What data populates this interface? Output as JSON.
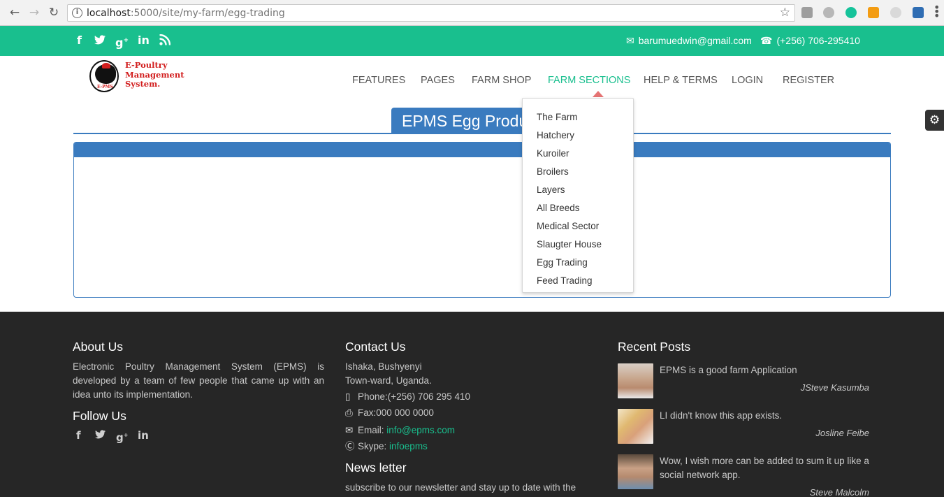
{
  "browser": {
    "url_host": "localhost",
    "url_path": ":5000/site/my-farm/egg-trading"
  },
  "topbar": {
    "social_icons": [
      "facebook-icon",
      "twitter-icon",
      "google-plus-icon",
      "linkedin-icon",
      "rss-icon"
    ],
    "email": "barumuedwin@gmail.com",
    "phone": "(+256) 706-295410"
  },
  "logo": {
    "line1": "E-Poultry",
    "line2": "Management",
    "line3": "System.",
    "badge": "E-PMS"
  },
  "nav": {
    "items": [
      "FEATURES",
      "PAGES",
      "FARM SHOP",
      "FARM SECTIONS",
      "HELP & TERMS",
      "LOGIN",
      "REGISTER"
    ],
    "active": "FARM SECTIONS"
  },
  "dropdown": {
    "items": [
      "The Farm",
      "Hatchery",
      "Kuroiler",
      "Broilers",
      "Layers",
      "All Breeds",
      "Medical Sector",
      "Slaugter House",
      "Egg Trading",
      "Feed Trading"
    ]
  },
  "page": {
    "title": "EPMS Egg Produ"
  },
  "footer": {
    "about": {
      "heading": "About Us",
      "text": "Electronic Poultry Management System (EPMS) is developed by a team of few people that came up with an idea unto its implementation."
    },
    "follow": {
      "heading": "Follow Us"
    },
    "contact": {
      "heading": "Contact Us",
      "address1": "Ishaka, Bushyenyi",
      "address2": "Town-ward, Uganda.",
      "phone": "Phone:(+256) 706 295 410",
      "fax": "Fax:000 000 0000",
      "email_label": "Email: ",
      "email_value": "info@epms.com",
      "skype_label": "Skype: ",
      "skype_value": "infoepms"
    },
    "newsletter": {
      "heading": "News letter",
      "text": "subscribe to our newsletter and stay up to date with the"
    },
    "recent": {
      "heading": "Recent Posts",
      "posts": [
        {
          "text": "EPMS is a good farm Application",
          "author": "JSteve Kasumba"
        },
        {
          "text": "LI didn't know this app exists.",
          "author": "Josline Feibe"
        },
        {
          "text": "Wow, I wish more can be added to sum it up like a social network app.",
          "author": "Steve Malcolm"
        }
      ]
    }
  },
  "colors": {
    "accent_green": "#19bf8e",
    "primary_blue": "#3a7bbf",
    "footer_bg": "#262626",
    "logo_red": "#d21e1e"
  }
}
